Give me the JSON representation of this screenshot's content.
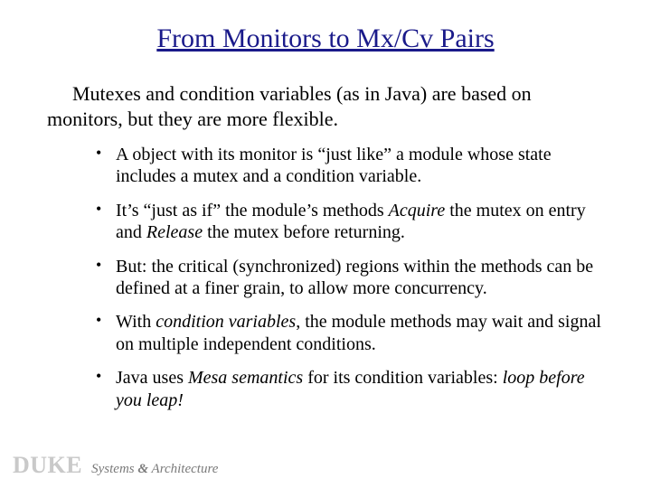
{
  "title": "From Monitors to Mx/Cv Pairs",
  "intro": "Mutexes and condition variables (as in Java) are based on monitors, but they are more flexible.",
  "bullets": [
    {
      "pre": "A object with its monitor is “just like” a module whose state includes a mutex and a condition variable."
    },
    {
      "pre": "It’s “just as if” the module’s methods ",
      "i1": "Acquire",
      "mid": " the mutex on entry and ",
      "i2": "Release",
      "post": " the mutex before returning."
    },
    {
      "pre": "But: the critical (synchronized) regions within the methods can be defined at a finer grain, to allow more concurrency."
    },
    {
      "pre": "With ",
      "i1": "condition variables",
      "post": ", the module methods may wait and signal on multiple independent conditions."
    },
    {
      "pre": "Java uses ",
      "i1": "Mesa semantics",
      "mid": " for its condition variables: ",
      "i2": "loop before you leap!"
    }
  ],
  "footer": {
    "brand": "DUKE",
    "tagline_a": "Systems ",
    "tagline_amp": "&",
    "tagline_b": " Architecture"
  }
}
